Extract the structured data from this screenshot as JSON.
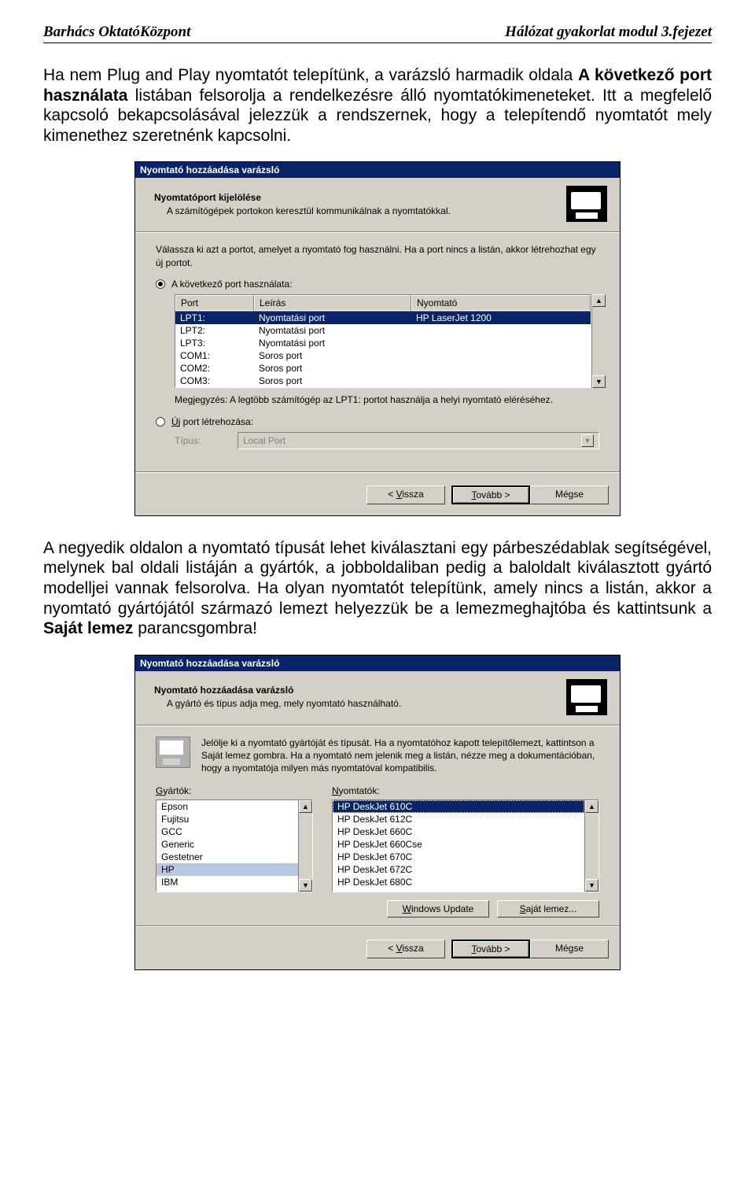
{
  "header": {
    "left": "Barhács OktatóKözpont",
    "right": "Hálózat gyakorlat modul 3.fejezet"
  },
  "para1_pre": "Ha nem Plug and Play nyomtatót telepítünk, a varázsló harmadik oldala ",
  "para1_bold": "A következő port használata",
  "para1_post": " listában felsorolja a rendelkezésre álló nyomtatókimeneteket. Itt a megfelelő kapcsoló bekapcsolásával jelezzük a rendszernek, hogy a telepítendő nyomtatót mely kimenethez szeretnénk kapcsolni.",
  "para2_pre": "A negyedik oldalon a nyomtató típusát lehet kiválasztani egy párbeszédablak segítségével, melynek bal oldali listáján a gyártók, a jobboldaliban pedig a baloldalt kiválasztott gyártó modelljei vannak felsorolva. Ha olyan nyomtatót telepítünk, amely nincs a listán, akkor a nyomtató gyártójától származó lemezt helyezzük be a lemezmeghajtóba és kattintsunk a ",
  "para2_bold": "Saját lemez",
  "para2_post": " parancsgombra!",
  "dialog1": {
    "title": "Nyomtató hozzáadása varázsló",
    "head_title": "Nyomtatóport kijelölése",
    "head_sub": "A számítógépek portokon keresztül kommunikálnak a nyomtatókkal.",
    "instr": "Válassza ki azt a portot, amelyet a nyomtató fog használni. Ha a port nincs a listán, akkor létrehozhat egy új portot.",
    "radio_use_label": "A következő port használata:",
    "cols": {
      "c1": "Port",
      "c2": "Leírás",
      "c3": "Nyomtató"
    },
    "rows": [
      {
        "c1": "LPT1:",
        "c2": "Nyomtatási port",
        "c3": "HP LaserJet 1200",
        "sel": true
      },
      {
        "c1": "LPT2:",
        "c2": "Nyomtatási port",
        "c3": ""
      },
      {
        "c1": "LPT3:",
        "c2": "Nyomtatási port",
        "c3": ""
      },
      {
        "c1": "COM1:",
        "c2": "Soros port",
        "c3": ""
      },
      {
        "c1": "COM2:",
        "c2": "Soros port",
        "c3": ""
      },
      {
        "c1": "COM3:",
        "c2": "Soros port",
        "c3": ""
      }
    ],
    "note": "Megjegyzés: A legtöbb számítógép az LPT1: portot használja a helyi nyomtató eléréséhez.",
    "radio_new_label": "Új port létrehozása:",
    "type_label": "Típus:",
    "type_value": "Local Port",
    "btn_back": "< Vissza",
    "btn_next": "Tovább >",
    "btn_cancel": "Mégse"
  },
  "dialog2": {
    "title": "Nyomtató hozzáadása varázsló",
    "head_title": "Nyomtató hozzáadása varázsló",
    "head_sub": "A gyártó és típus adja meg, mely nyomtató használható.",
    "msg": "Jelölje ki a nyomtató gyártóját és típusát. Ha a nyomtatóhoz kapott telepítőlemezt, kattintson a Saját lemez gombra. Ha a nyomtató nem jelenik meg a listán, nézze meg a dokumentációban, hogy a nyomtatója milyen más nyomtatóval kompatibilis.",
    "makers_label": "Gyártók:",
    "printers_label": "Nyomtatók:",
    "makers": [
      "Epson",
      "Fujitsu",
      "GCC",
      "Generic",
      "Gestetner",
      "HP",
      "IBM"
    ],
    "maker_selected": "HP",
    "printers": [
      "HP DeskJet 610C",
      "HP DeskJet 612C",
      "HP DeskJet 660C",
      "HP DeskJet 660Cse",
      "HP DeskJet 670C",
      "HP DeskJet 672C",
      "HP DeskJet 680C"
    ],
    "printer_selected": "HP DeskJet 610C",
    "btn_update": "Windows Update",
    "btn_disk": "Saját lemez...",
    "btn_back": "< Vissza",
    "btn_next": "Tovább >",
    "btn_cancel": "Mégse"
  }
}
